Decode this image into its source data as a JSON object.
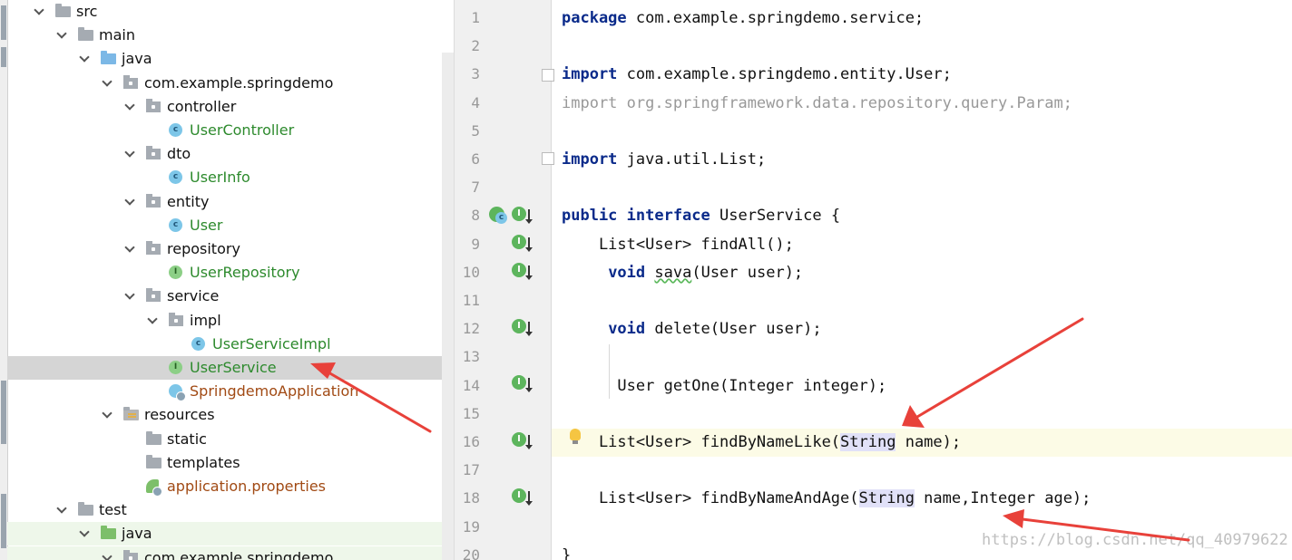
{
  "project_tree": {
    "items": [
      {
        "label": "src",
        "icon": "folder-icon",
        "expanded": true
      },
      {
        "label": "main",
        "icon": "folder-icon",
        "expanded": true
      },
      {
        "label": "java",
        "icon": "source-folder-icon",
        "expanded": true
      },
      {
        "label": "com.example.springdemo",
        "icon": "package-icon",
        "expanded": true
      },
      {
        "label": "controller",
        "icon": "package-icon",
        "expanded": true
      },
      {
        "label": "UserController",
        "icon": "class-icon"
      },
      {
        "label": "dto",
        "icon": "package-icon",
        "expanded": true
      },
      {
        "label": "UserInfo",
        "icon": "class-icon"
      },
      {
        "label": "entity",
        "icon": "package-icon",
        "expanded": true
      },
      {
        "label": "User",
        "icon": "class-icon"
      },
      {
        "label": "repository",
        "icon": "package-icon",
        "expanded": true
      },
      {
        "label": "UserRepository",
        "icon": "interface-icon"
      },
      {
        "label": "service",
        "icon": "package-icon",
        "expanded": true
      },
      {
        "label": "impl",
        "icon": "package-icon",
        "expanded": true
      },
      {
        "label": "UserServiceImpl",
        "icon": "class-icon"
      },
      {
        "label": "UserService",
        "icon": "interface-icon",
        "selected": true
      },
      {
        "label": "SpringdemoApplication",
        "icon": "spring-boot-app-icon"
      },
      {
        "label": "resources",
        "icon": "resources-folder-icon",
        "expanded": true
      },
      {
        "label": "static",
        "icon": "folder-icon"
      },
      {
        "label": "templates",
        "icon": "folder-icon"
      },
      {
        "label": "application.properties",
        "icon": "spring-properties-icon"
      },
      {
        "label": "test",
        "icon": "folder-icon",
        "expanded": true
      },
      {
        "label": "java",
        "icon": "test-source-folder-icon",
        "expanded": true
      },
      {
        "label": "com.example.springdemo",
        "icon": "package-icon",
        "expanded": true
      }
    ]
  },
  "editor": {
    "line_numbers": [
      "1",
      "2",
      "3",
      "4",
      "5",
      "6",
      "7",
      "8",
      "9",
      "10",
      "11",
      "12",
      "13",
      "14",
      "15",
      "16",
      "17",
      "18",
      "19",
      "20"
    ],
    "current_line": 16,
    "lines": [
      [
        {
          "t": "package",
          "k": "kw"
        },
        {
          "t": " com.example.springdemo.service;"
        }
      ],
      [],
      [
        {
          "t": "import",
          "k": "kw"
        },
        {
          "t": " com.example.springdemo.entity.User;"
        }
      ],
      [
        {
          "t": "import org.springframework.data.repository.query.Param;",
          "k": "gray"
        }
      ],
      [],
      [
        {
          "t": "import",
          "k": "kw"
        },
        {
          "t": " java.util.List;"
        }
      ],
      [],
      [
        {
          "t": "public interface",
          "k": "kw"
        },
        {
          "t": " UserService {"
        }
      ],
      [
        {
          "t": "    List<User> findAll();"
        }
      ],
      [
        {
          "t": "     "
        },
        {
          "t": "void",
          "k": "kw"
        },
        {
          "t": " "
        },
        {
          "t": "sava",
          "k": "squig"
        },
        {
          "t": "(User user);"
        }
      ],
      [],
      [
        {
          "t": "     "
        },
        {
          "t": "void",
          "k": "kw"
        },
        {
          "t": " delete(User user);"
        }
      ],
      [],
      [
        {
          "t": "      User getOne(Integer integer);"
        }
      ],
      [],
      [
        {
          "t": "    List<User> findByNameLike("
        },
        {
          "t": "String",
          "k": "hl"
        },
        {
          "t": " name);"
        }
      ],
      [],
      [
        {
          "t": "    List<User> findByNameAndAge("
        },
        {
          "t": "String",
          "k": "hl"
        },
        {
          "t": " name,Integer age);"
        }
      ],
      [],
      [
        {
          "t": "}"
        }
      ]
    ],
    "watermark": "https://blog.csdn.net/qq_40979622"
  },
  "colors": {
    "keyword": "#0a2a8a",
    "annotation_arrow": "#e8413a",
    "selected_row": "#d5d5d5",
    "current_line": "#fcfbe6"
  }
}
